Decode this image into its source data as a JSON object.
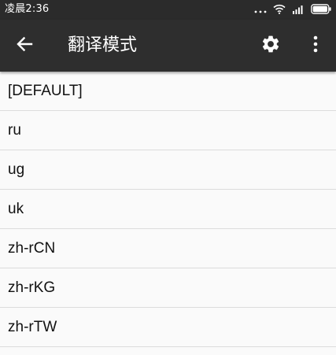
{
  "status_bar": {
    "time": "凌晨2:36",
    "icons": [
      "dots-icon",
      "wifi-icon",
      "signal-icon",
      "battery-icon"
    ]
  },
  "toolbar": {
    "title": "翻译模式",
    "back_icon": "arrow-left-icon",
    "settings_icon": "gear-icon",
    "overflow_icon": "more-vert-icon",
    "background": "#2e2e2e"
  },
  "list": {
    "items": [
      {
        "label": "[DEFAULT]"
      },
      {
        "label": "ru"
      },
      {
        "label": "ug"
      },
      {
        "label": "uk"
      },
      {
        "label": "zh-rCN"
      },
      {
        "label": "zh-rKG"
      },
      {
        "label": "zh-rTW"
      }
    ]
  }
}
